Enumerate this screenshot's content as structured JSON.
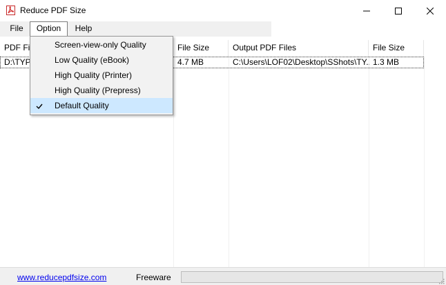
{
  "window": {
    "title": "Reduce PDF Size"
  },
  "menubar": {
    "items": [
      {
        "label": "File"
      },
      {
        "label": "Option"
      },
      {
        "label": "Help"
      }
    ]
  },
  "list": {
    "columns": [
      {
        "label": "PDF Files"
      },
      {
        "label": "File Size"
      },
      {
        "label": "Output PDF Files"
      },
      {
        "label": "File Size"
      }
    ],
    "rows": [
      {
        "input": "D:\\TYP",
        "input_size": "4.7 MB",
        "output": "C:\\Users\\LOF02\\Desktop\\SShots\\TY...",
        "output_size": "1.3 MB"
      }
    ]
  },
  "option_menu": {
    "items": [
      {
        "label": "Screen-view-only Quality",
        "checked": false
      },
      {
        "label": "Low Quality (eBook)",
        "checked": false
      },
      {
        "label": "High Quality (Printer)",
        "checked": false
      },
      {
        "label": "High Quality (Prepress)",
        "checked": false
      },
      {
        "label": "Default Quality",
        "checked": true
      }
    ]
  },
  "statusbar": {
    "link": "www.reducepdfsize.com",
    "license": "Freeware",
    "progress_fraction": 0
  },
  "colors": {
    "menu_highlight": "#cde8ff",
    "link": "#0000ee",
    "progress_fill": "#06b025"
  }
}
